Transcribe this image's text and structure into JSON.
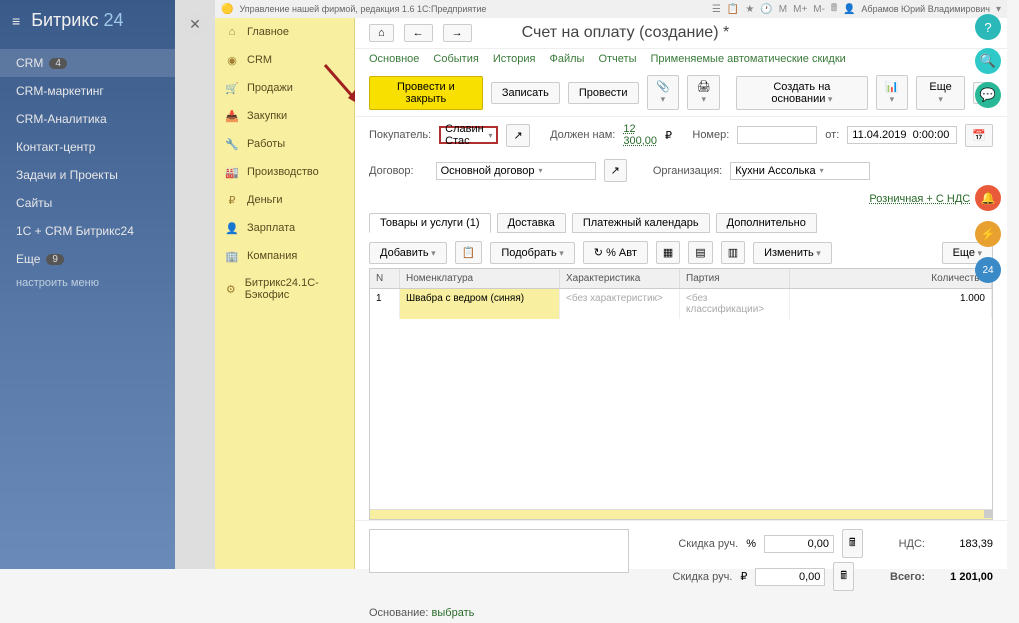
{
  "bitrix": {
    "brand_a": "Битрикс",
    "brand_b": "24",
    "items": [
      {
        "label": "CRM",
        "badge": "4",
        "active": true
      },
      {
        "label": "CRM-маркетинг"
      },
      {
        "label": "CRM-Аналитика"
      },
      {
        "label": "Контакт-центр"
      },
      {
        "label": "Задачи и Проекты"
      },
      {
        "label": "Сайты"
      },
      {
        "label": "1С + CRM Битрикс24"
      },
      {
        "label": "Еще",
        "badge": "9"
      }
    ],
    "config": "настроить меню"
  },
  "title_bar": {
    "app": "Управление нашей фирмой, редакция 1.6   1С:Предприятие",
    "user": "Абрамов Юрий Владимирович"
  },
  "onec_menu": [
    {
      "ico": "⌂",
      "label": "Главное"
    },
    {
      "ico": "◉",
      "label": "CRM"
    },
    {
      "ico": "🛒",
      "label": "Продажи"
    },
    {
      "ico": "📥",
      "label": "Закупки"
    },
    {
      "ico": "🔧",
      "label": "Работы"
    },
    {
      "ico": "🏭",
      "label": "Производство"
    },
    {
      "ico": "₽",
      "label": "Деньги"
    },
    {
      "ico": "👤",
      "label": "Зарплата"
    },
    {
      "ico": "🏢",
      "label": "Компания"
    },
    {
      "ico": "⚙",
      "label": "Битрикс24.1С-Бэкофис"
    }
  ],
  "main": {
    "title": "Счет на оплату (создание) *",
    "tabs": [
      "Основное",
      "События",
      "История",
      "Файлы",
      "Отчеты",
      "Применяемые автоматические скидки"
    ],
    "toolbar": {
      "primary": "Провести и закрыть",
      "save": "Записать",
      "post": "Провести",
      "create_on": "Создать на основании",
      "more": "Еще",
      "help": "?"
    },
    "form": {
      "buyer_lbl": "Покупатель:",
      "buyer_val": "Славин Стас",
      "owes_lbl": "Должен нам:",
      "owes_val": "12 300,00",
      "owes_cur": "₽",
      "number_lbl": "Номер:",
      "from_lbl": "от:",
      "date_val": "11.04.2019  0:00:00",
      "contract_lbl": "Договор:",
      "contract_val": "Основной договор",
      "org_lbl": "Организация:",
      "org_val": "Кухни Ассолька"
    },
    "price_link": "Розничная + С НДС",
    "subtabs": [
      "Товары и услуги (1)",
      "Доставка",
      "Платежный календарь",
      "Дополнительно"
    ],
    "grid_toolbar": {
      "add": "Добавить",
      "select": "Подобрать",
      "pct": "% Авт",
      "change": "Изменить",
      "more": "Еще"
    },
    "grid": {
      "cols": [
        "N",
        "Номенклатура",
        "Характеристика",
        "Партия",
        "Количество"
      ],
      "rows": [
        {
          "n": "1",
          "nom": "Швабра с ведром (синяя)",
          "char": "<без характеристик>",
          "part": "<без классификации>",
          "qty": "1.000"
        }
      ]
    },
    "footer": {
      "discount_manual_lbl": "Скидка руч.",
      "discount_pct": "%",
      "discount_val": "0,00",
      "discount_rub_lbl": "Скидка руч.",
      "discount_rub_sym": "₽",
      "discount_rub_val": "0,00",
      "nds_lbl": "НДС:",
      "nds_val": "183,39",
      "total_lbl": "Всего:",
      "total_val": "1 201,00",
      "osn_lbl": "Основание:",
      "osn_link": "выбрать"
    }
  },
  "float": {
    "b24": "24"
  }
}
